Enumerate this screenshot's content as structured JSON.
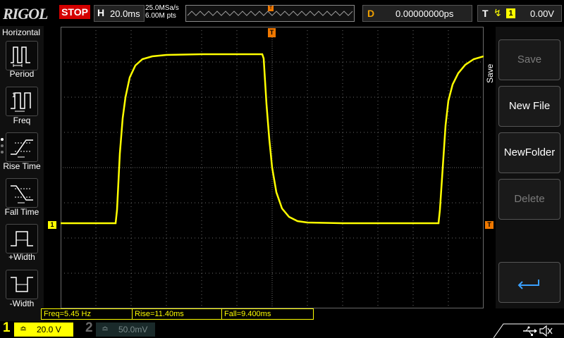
{
  "brand": "RIGOL",
  "run_state": "STOP",
  "horizontal": {
    "label": "H",
    "timebase": "20.0ms",
    "sample_rate": "25.0MSa/s",
    "memory_depth": "6.00M pts"
  },
  "delay": {
    "label": "D",
    "value": "0.00000000ps"
  },
  "trigger": {
    "label": "T",
    "edge_icon": "rising-edge-icon",
    "source": "1",
    "level": "0.00V"
  },
  "left_menu": {
    "title": "Horizontal",
    "items": [
      {
        "label": "Period",
        "icon": "period-icon"
      },
      {
        "label": "Freq",
        "icon": "freq-icon"
      },
      {
        "label": "Rise Time",
        "icon": "rise-time-icon"
      },
      {
        "label": "Fall Time",
        "icon": "fall-time-icon"
      },
      {
        "label": "+Width",
        "icon": "pos-width-icon"
      },
      {
        "label": "-Width",
        "icon": "neg-width-icon"
      }
    ]
  },
  "right_menu": {
    "title": "Save",
    "items": [
      {
        "label": "Save",
        "enabled": false
      },
      {
        "label": "New File",
        "enabled": true
      },
      {
        "label": "NewFolder",
        "enabled": true
      },
      {
        "label": "Delete",
        "enabled": false
      },
      {
        "label": "",
        "icon": "return-icon",
        "enabled": true
      }
    ]
  },
  "measurements": [
    "Freq=5.45 Hz",
    "Rise=11.40ms",
    "Fall=9.400ms"
  ],
  "channels": [
    {
      "num": "1",
      "coupling": "≏",
      "scale": "20.0 V",
      "active": true
    },
    {
      "num": "2",
      "coupling": "≏",
      "scale": "50.0mV",
      "active": false
    }
  ],
  "markers": {
    "ch1": "1",
    "trigger_level": "T",
    "trigger_position": "T"
  },
  "status_icons": [
    "usb-icon",
    "mute-icon"
  ],
  "colors": {
    "ch1": "#ffff00",
    "trigger": "#f07800",
    "stop": "#d40000",
    "grid": "#6a6a6a"
  }
}
